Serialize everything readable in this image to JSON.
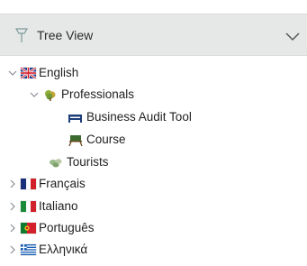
{
  "panel": {
    "title": "Tree View",
    "pin_icon": "pushpin-icon",
    "collapse_icon": "chevron-down-icon"
  },
  "tree": {
    "english": {
      "label": "English",
      "icon": "flag-uk-icon",
      "expanded": true
    },
    "professionals": {
      "label": "Professionals",
      "icon": "tree-icon",
      "expanded": true
    },
    "business_audit_tool": {
      "label": "Business Audit Tool",
      "icon": "bed-icon"
    },
    "course": {
      "label": "Course",
      "icon": "board-icon"
    },
    "tourists": {
      "label": "Tourists",
      "icon": "plant-icon"
    },
    "francais": {
      "label": "Français",
      "icon": "flag-france-icon",
      "expanded": false
    },
    "italiano": {
      "label": "Italiano",
      "icon": "flag-italy-icon",
      "expanded": false
    },
    "portugues": {
      "label": "Português",
      "icon": "flag-portugal-icon",
      "expanded": false
    },
    "ellinika": {
      "label": "Ελληνικά",
      "icon": "flag-greece-icon",
      "expanded": false
    }
  },
  "colors": {
    "header_bg": "#e6e8e7",
    "arrow": "#8a8f95",
    "text": "#1f1f1f"
  }
}
